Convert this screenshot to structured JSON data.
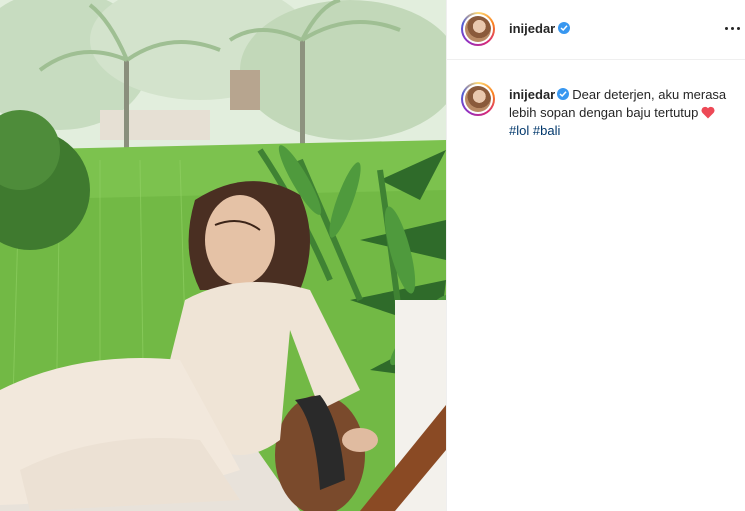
{
  "post": {
    "author": {
      "username": "inijedar",
      "verified": true,
      "avatar_icon": "profile-avatar"
    },
    "header": {
      "more_icon": "more-horizontal-icon"
    },
    "caption": {
      "username": "inijedar",
      "text": "Dear deterjen, aku merasa lebih sopan dengan baju tertutup",
      "emoji": "red-heart",
      "hashtags": [
        "#lol",
        "#bali"
      ]
    },
    "photo": {
      "subject": "woman in cream linen outfit sitting by rice terraces"
    }
  },
  "colors": {
    "verified": "#3897f0",
    "hashtag": "#00376b",
    "heart": "#ed4956",
    "border": "#efefef"
  }
}
